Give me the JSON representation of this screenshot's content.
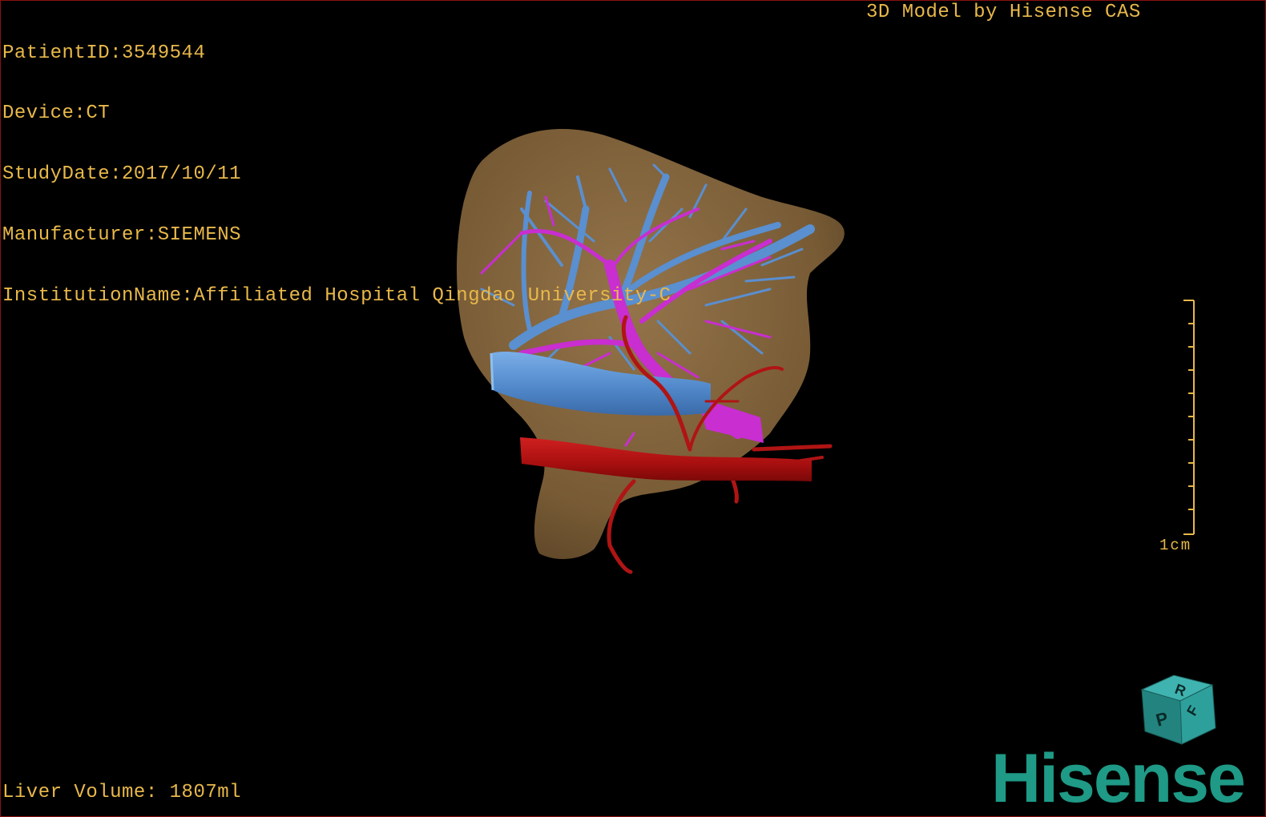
{
  "header": {
    "info_lines": [
      "PatientID:3549544",
      "Device:CT",
      "StudyDate:2017/10/11",
      "Manufacturer:SIEMENS",
      "InstitutionName:Affiliated Hospital Qingdao University-C"
    ],
    "title": "3D Model by Hisense CAS"
  },
  "footer": {
    "liver_volume": "Liver Volume: 1807ml"
  },
  "scale": {
    "label": "1cm"
  },
  "orientation_cube": {
    "face_top": "R",
    "face_front": "P",
    "face_side": "F"
  },
  "brand": {
    "logo_text": "Hisense"
  },
  "colors": {
    "text": "#e8b84a",
    "liver": "#8a6a42",
    "hepatic_vein": "#5a8fd0",
    "portal_vein": "#c82ed0",
    "artery": "#b01414",
    "brand": "#1e9a86"
  }
}
